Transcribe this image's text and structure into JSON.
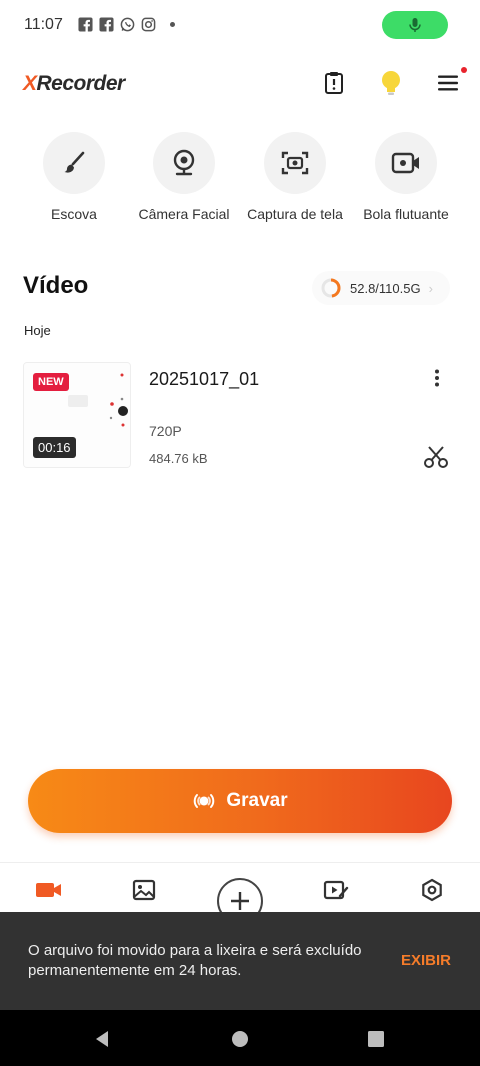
{
  "status_bar": {
    "time": "11:07",
    "icons": [
      "facebook-icon",
      "facebook-icon",
      "whatsapp-icon",
      "instagram-icon",
      "dot-icon"
    ],
    "mic_pill_color": "#3ddc67"
  },
  "header": {
    "logo_x": "X",
    "logo_rest": "Recorder",
    "icons": [
      "clipboard-alert-icon",
      "lightbulb-icon",
      "menu-icon"
    ]
  },
  "tools": [
    {
      "label": "Escova",
      "icon": "brush-icon"
    },
    {
      "label": "Câmera Facial",
      "icon": "webcam-icon"
    },
    {
      "label": "Captura de tela",
      "icon": "screenshot-icon"
    },
    {
      "label": "Bola flutuante",
      "icon": "floating-video-icon"
    }
  ],
  "video_section": {
    "title": "Vídeo",
    "storage": "52.8/110.5G",
    "storage_used_fraction": 0.478
  },
  "date_group": "Hoje",
  "video": {
    "badge": "NEW",
    "duration": "00:16",
    "name": "20251017_01",
    "resolution": "720P",
    "size": "484.76 kB"
  },
  "record_button": {
    "label": "Gravar"
  },
  "bottom_nav": {
    "items": [
      "video-tab-icon",
      "image-tab-icon",
      "plus-icon",
      "edit-video-tab-icon",
      "settings-tab-icon"
    ]
  },
  "snackbar": {
    "message": "O arquivo foi movido para a lixeira e será excluído permanentemente em 24 horas.",
    "action": "EXIBIR"
  },
  "colors": {
    "accent": "#f05a24",
    "record_gradient_start": "#f78a16",
    "record_gradient_end": "#e8461f",
    "badge_new": "#e41e3f",
    "snackbar_bg": "#323232",
    "snackbar_action": "#f57c2a"
  }
}
